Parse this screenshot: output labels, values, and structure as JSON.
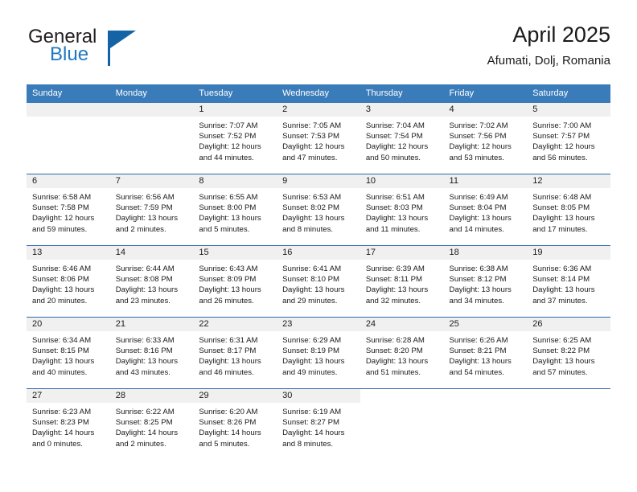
{
  "brand": {
    "name_part1": "General",
    "name_part2": "Blue",
    "logo_icon": "blue-triangle-logo"
  },
  "header": {
    "title": "April 2025",
    "location": "Afumati, Dolj, Romania"
  },
  "colors": {
    "header_blue": "#3a7cba",
    "separator_blue": "#2a69ac",
    "daynum_strip": "#f0f0f0",
    "brand_blue": "#1f77c4",
    "logo_blue": "#1464a5"
  },
  "weekdays": [
    "Sunday",
    "Monday",
    "Tuesday",
    "Wednesday",
    "Thursday",
    "Friday",
    "Saturday"
  ],
  "labels": {
    "sunrise_prefix": "Sunrise: ",
    "sunset_prefix": "Sunset: ",
    "daylight_prefix": "Daylight: "
  },
  "weeks": [
    [
      {
        "day": "",
        "lines": []
      },
      {
        "day": "",
        "lines": []
      },
      {
        "day": "1",
        "lines": [
          "Sunrise: 7:07 AM",
          "Sunset: 7:52 PM",
          "Daylight: 12 hours",
          "and 44 minutes."
        ]
      },
      {
        "day": "2",
        "lines": [
          "Sunrise: 7:05 AM",
          "Sunset: 7:53 PM",
          "Daylight: 12 hours",
          "and 47 minutes."
        ]
      },
      {
        "day": "3",
        "lines": [
          "Sunrise: 7:04 AM",
          "Sunset: 7:54 PM",
          "Daylight: 12 hours",
          "and 50 minutes."
        ]
      },
      {
        "day": "4",
        "lines": [
          "Sunrise: 7:02 AM",
          "Sunset: 7:56 PM",
          "Daylight: 12 hours",
          "and 53 minutes."
        ]
      },
      {
        "day": "5",
        "lines": [
          "Sunrise: 7:00 AM",
          "Sunset: 7:57 PM",
          "Daylight: 12 hours",
          "and 56 minutes."
        ]
      }
    ],
    [
      {
        "day": "6",
        "lines": [
          "Sunrise: 6:58 AM",
          "Sunset: 7:58 PM",
          "Daylight: 12 hours",
          "and 59 minutes."
        ]
      },
      {
        "day": "7",
        "lines": [
          "Sunrise: 6:56 AM",
          "Sunset: 7:59 PM",
          "Daylight: 13 hours",
          "and 2 minutes."
        ]
      },
      {
        "day": "8",
        "lines": [
          "Sunrise: 6:55 AM",
          "Sunset: 8:00 PM",
          "Daylight: 13 hours",
          "and 5 minutes."
        ]
      },
      {
        "day": "9",
        "lines": [
          "Sunrise: 6:53 AM",
          "Sunset: 8:02 PM",
          "Daylight: 13 hours",
          "and 8 minutes."
        ]
      },
      {
        "day": "10",
        "lines": [
          "Sunrise: 6:51 AM",
          "Sunset: 8:03 PM",
          "Daylight: 13 hours",
          "and 11 minutes."
        ]
      },
      {
        "day": "11",
        "lines": [
          "Sunrise: 6:49 AM",
          "Sunset: 8:04 PM",
          "Daylight: 13 hours",
          "and 14 minutes."
        ]
      },
      {
        "day": "12",
        "lines": [
          "Sunrise: 6:48 AM",
          "Sunset: 8:05 PM",
          "Daylight: 13 hours",
          "and 17 minutes."
        ]
      }
    ],
    [
      {
        "day": "13",
        "lines": [
          "Sunrise: 6:46 AM",
          "Sunset: 8:06 PM",
          "Daylight: 13 hours",
          "and 20 minutes."
        ]
      },
      {
        "day": "14",
        "lines": [
          "Sunrise: 6:44 AM",
          "Sunset: 8:08 PM",
          "Daylight: 13 hours",
          "and 23 minutes."
        ]
      },
      {
        "day": "15",
        "lines": [
          "Sunrise: 6:43 AM",
          "Sunset: 8:09 PM",
          "Daylight: 13 hours",
          "and 26 minutes."
        ]
      },
      {
        "day": "16",
        "lines": [
          "Sunrise: 6:41 AM",
          "Sunset: 8:10 PM",
          "Daylight: 13 hours",
          "and 29 minutes."
        ]
      },
      {
        "day": "17",
        "lines": [
          "Sunrise: 6:39 AM",
          "Sunset: 8:11 PM",
          "Daylight: 13 hours",
          "and 32 minutes."
        ]
      },
      {
        "day": "18",
        "lines": [
          "Sunrise: 6:38 AM",
          "Sunset: 8:12 PM",
          "Daylight: 13 hours",
          "and 34 minutes."
        ]
      },
      {
        "day": "19",
        "lines": [
          "Sunrise: 6:36 AM",
          "Sunset: 8:14 PM",
          "Daylight: 13 hours",
          "and 37 minutes."
        ]
      }
    ],
    [
      {
        "day": "20",
        "lines": [
          "Sunrise: 6:34 AM",
          "Sunset: 8:15 PM",
          "Daylight: 13 hours",
          "and 40 minutes."
        ]
      },
      {
        "day": "21",
        "lines": [
          "Sunrise: 6:33 AM",
          "Sunset: 8:16 PM",
          "Daylight: 13 hours",
          "and 43 minutes."
        ]
      },
      {
        "day": "22",
        "lines": [
          "Sunrise: 6:31 AM",
          "Sunset: 8:17 PM",
          "Daylight: 13 hours",
          "and 46 minutes."
        ]
      },
      {
        "day": "23",
        "lines": [
          "Sunrise: 6:29 AM",
          "Sunset: 8:19 PM",
          "Daylight: 13 hours",
          "and 49 minutes."
        ]
      },
      {
        "day": "24",
        "lines": [
          "Sunrise: 6:28 AM",
          "Sunset: 8:20 PM",
          "Daylight: 13 hours",
          "and 51 minutes."
        ]
      },
      {
        "day": "25",
        "lines": [
          "Sunrise: 6:26 AM",
          "Sunset: 8:21 PM",
          "Daylight: 13 hours",
          "and 54 minutes."
        ]
      },
      {
        "day": "26",
        "lines": [
          "Sunrise: 6:25 AM",
          "Sunset: 8:22 PM",
          "Daylight: 13 hours",
          "and 57 minutes."
        ]
      }
    ],
    [
      {
        "day": "27",
        "lines": [
          "Sunrise: 6:23 AM",
          "Sunset: 8:23 PM",
          "Daylight: 14 hours",
          "and 0 minutes."
        ]
      },
      {
        "day": "28",
        "lines": [
          "Sunrise: 6:22 AM",
          "Sunset: 8:25 PM",
          "Daylight: 14 hours",
          "and 2 minutes."
        ]
      },
      {
        "day": "29",
        "lines": [
          "Sunrise: 6:20 AM",
          "Sunset: 8:26 PM",
          "Daylight: 14 hours",
          "and 5 minutes."
        ]
      },
      {
        "day": "30",
        "lines": [
          "Sunrise: 6:19 AM",
          "Sunset: 8:27 PM",
          "Daylight: 14 hours",
          "and 8 minutes."
        ]
      },
      {
        "day": "",
        "lines": []
      },
      {
        "day": "",
        "lines": []
      },
      {
        "day": "",
        "lines": []
      }
    ]
  ]
}
